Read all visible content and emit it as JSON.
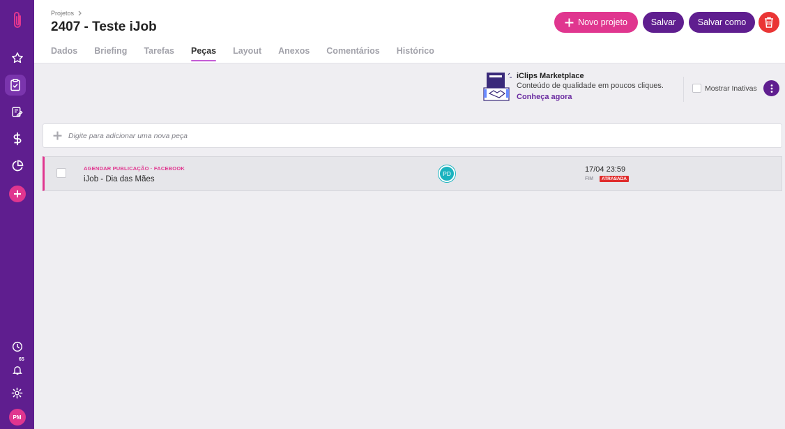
{
  "colors": {
    "sidebar": "#5f1e8f",
    "accent_pink": "#e0368f",
    "primary": "#5f1e8f",
    "danger": "#ea3535",
    "avatar_teal": "#1bb3bf"
  },
  "sidebar": {
    "logo": "paperclip-icon",
    "items": [
      "star-icon",
      "clipboard-check-icon",
      "edit-document-icon",
      "dollar-icon",
      "pie-chart-icon",
      "plus-icon"
    ],
    "bottom": [
      "clock-icon",
      "bell-icon",
      "gear-icon"
    ],
    "notification_count": "65",
    "user_initials": "PM"
  },
  "header": {
    "breadcrumb": "Projetos",
    "title": "2407 - Teste iJob",
    "buttons": {
      "new_project": "Novo projeto",
      "save": "Salvar",
      "save_as": "Salvar como"
    },
    "tabs": [
      "Dados",
      "Briefing",
      "Tarefas",
      "Peças",
      "Layout",
      "Anexos",
      "Comentários",
      "Histórico"
    ],
    "active_tab": "Peças"
  },
  "marketplace": {
    "title": "iClips Marketplace",
    "subtitle": "Conteúdo de qualidade em poucos cliques.",
    "link": "Conheça agora"
  },
  "filters": {
    "show_inactive": "Mostrar Inativas",
    "show_inactive_checked": false
  },
  "add_piece": {
    "placeholder": "Digite para adicionar uma nova peça"
  },
  "pieces": [
    {
      "tags": "AGENDAR PUBLICAÇÃO · FACEBOOK",
      "name": "iJob - Dia das Mães",
      "assignee_initials": "PD",
      "due": "17/04 23:59",
      "due_label": "FIM",
      "status": "ATRASADA"
    }
  ]
}
